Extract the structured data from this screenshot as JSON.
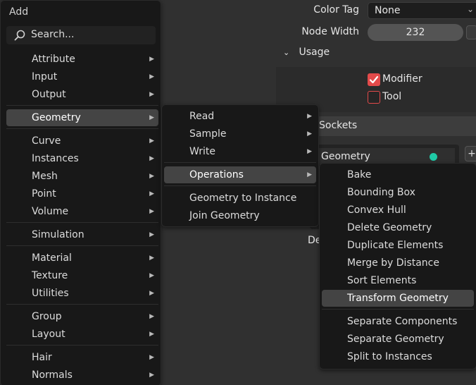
{
  "properties": {
    "color_tag_label": "Color Tag",
    "color_tag_value": "None",
    "node_width_label": "Node Width",
    "node_width_value": "232",
    "usage_header": "Usage",
    "modifier_label": "Modifier",
    "modifier_checked": true,
    "tool_label": "Tool",
    "tool_checked": false,
    "sockets_header": "o Sockets",
    "socket_name": "Geometry",
    "socket_color": "#1fc9a6",
    "plus_label": "+",
    "partial_label": "De"
  },
  "add_menu": {
    "title": "Add",
    "search_label": "Search...",
    "items": [
      {
        "label": "Attribute",
        "submenu": true
      },
      {
        "label": "Input",
        "submenu": true
      },
      {
        "label": "Output",
        "submenu": true
      },
      {
        "label": "Geometry",
        "submenu": true,
        "active": true
      },
      {
        "label": "Curve",
        "submenu": true
      },
      {
        "label": "Instances",
        "submenu": true
      },
      {
        "label": "Mesh",
        "submenu": true
      },
      {
        "label": "Point",
        "submenu": true
      },
      {
        "label": "Volume",
        "submenu": true
      },
      {
        "label": "Simulation",
        "submenu": true
      },
      {
        "label": "Material",
        "submenu": true
      },
      {
        "label": "Texture",
        "submenu": true
      },
      {
        "label": "Utilities",
        "submenu": true
      },
      {
        "label": "Group",
        "submenu": true
      },
      {
        "label": "Layout",
        "submenu": true
      },
      {
        "label": "Hair",
        "submenu": true
      },
      {
        "label": "Normals",
        "submenu": true
      }
    ]
  },
  "geometry_menu": {
    "items": [
      {
        "label": "Read",
        "submenu": true
      },
      {
        "label": "Sample",
        "submenu": true
      },
      {
        "label": "Write",
        "submenu": true
      },
      {
        "label": "Operations",
        "submenu": true,
        "active": true
      },
      {
        "label": "Geometry to Instance",
        "submenu": false
      },
      {
        "label": "Join Geometry",
        "submenu": false
      }
    ]
  },
  "operations_menu": {
    "items": [
      {
        "label": "Bake"
      },
      {
        "label": "Bounding Box"
      },
      {
        "label": "Convex Hull"
      },
      {
        "label": "Delete Geometry"
      },
      {
        "label": "Duplicate Elements"
      },
      {
        "label": "Merge by Distance"
      },
      {
        "label": "Sort Elements"
      },
      {
        "label": "Transform Geometry",
        "active": true
      },
      {
        "label": "Separate Components"
      },
      {
        "label": "Separate Geometry"
      },
      {
        "label": "Split to Instances"
      }
    ]
  },
  "colors": {
    "menu_bg": "#181818",
    "highlight": "#444444",
    "checkbox_red": "#e34a4a",
    "panel_bg": "#303030"
  }
}
